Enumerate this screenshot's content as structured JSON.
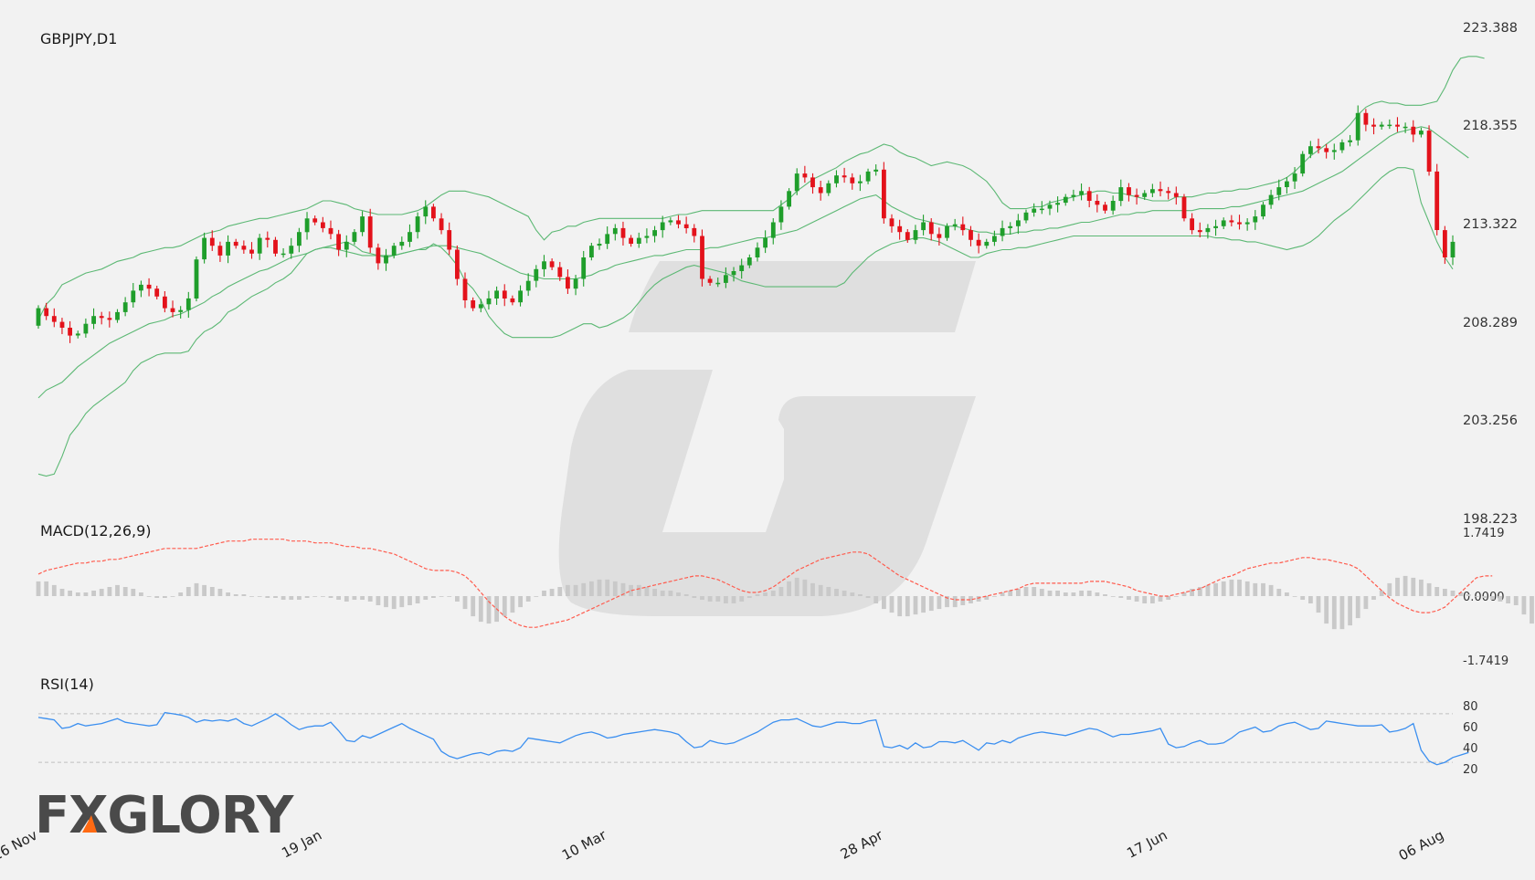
{
  "chart_data": {
    "type": "candlestick",
    "symbol_label": "GBPJPY,D1",
    "price_axis": {
      "ticks": [
        "223.388",
        "218.355",
        "213.322",
        "208.289",
        "203.256",
        "198.223"
      ],
      "ylim": [
        198.223,
        223.388
      ]
    },
    "date_ticks": [
      {
        "label": "26 Nov",
        "index": 0
      },
      {
        "label": "19 Jan",
        "index": 36
      },
      {
        "label": "10 Mar",
        "index": 72
      },
      {
        "label": "28 Apr",
        "index": 107
      },
      {
        "label": "17 Jun",
        "index": 143
      },
      {
        "label": "06 Aug",
        "index": 178
      }
    ],
    "candle_count": 180,
    "closes": [
      209.0,
      208.6,
      208.3,
      208.0,
      207.6,
      207.7,
      208.2,
      208.6,
      208.5,
      208.4,
      208.8,
      209.3,
      209.9,
      210.2,
      210.0,
      209.6,
      209.0,
      208.8,
      208.9,
      209.5,
      211.5,
      212.6,
      212.2,
      211.7,
      212.4,
      212.2,
      212.0,
      211.8,
      212.6,
      212.5,
      211.8,
      211.8,
      212.2,
      212.9,
      213.6,
      213.4,
      213.1,
      212.8,
      212.0,
      212.4,
      212.9,
      213.7,
      212.1,
      211.3,
      211.7,
      212.2,
      212.4,
      212.9,
      213.7,
      214.2,
      213.6,
      213.0,
      212.0,
      210.5,
      209.4,
      209.0,
      209.2,
      209.5,
      209.9,
      209.5,
      209.3,
      209.9,
      210.4,
      211.0,
      211.4,
      211.1,
      210.6,
      210.0,
      210.5,
      211.6,
      212.2,
      212.3,
      212.8,
      213.1,
      212.6,
      212.3,
      212.6,
      212.7,
      213.0,
      213.4,
      213.5,
      213.3,
      213.1,
      212.7,
      210.5,
      210.3,
      210.3,
      210.7,
      210.9,
      211.2,
      211.6,
      212.1,
      212.6,
      213.4,
      214.2,
      215.0,
      215.9,
      215.7,
      215.2,
      214.9,
      215.4,
      215.8,
      215.7,
      215.4,
      215.5,
      216.0,
      216.1,
      213.6,
      213.2,
      212.9,
      212.5,
      213.0,
      213.4,
      212.8,
      212.6,
      213.2,
      213.3,
      213.0,
      212.5,
      212.2,
      212.4,
      212.7,
      213.1,
      213.2,
      213.5,
      213.9,
      214.1,
      214.1,
      214.3,
      214.4,
      214.7,
      214.8,
      215.0,
      214.5,
      214.3,
      214.0,
      214.5,
      215.2,
      214.8,
      214.7,
      214.9,
      215.1,
      215.0,
      214.9,
      214.7,
      213.6,
      213.0,
      212.9,
      213.1,
      213.2,
      213.5,
      213.4,
      213.3,
      213.4,
      213.7,
      214.3,
      214.8,
      215.2,
      215.5,
      215.9,
      216.9,
      217.3,
      217.2,
      217.0,
      217.1,
      217.5,
      217.6,
      219.0,
      218.4,
      218.3,
      218.4,
      218.4,
      218.3,
      218.3,
      217.9,
      218.1,
      216.0,
      213.0,
      211.6,
      212.4,
      212.7,
      213.3
    ],
    "bollinger": {
      "bands": [
        "upper",
        "middle",
        "lower"
      ],
      "upper": [
        208.4,
        209.2,
        209.6,
        210.2,
        210.4,
        210.6,
        210.8,
        210.9,
        211.0,
        211.2,
        211.4,
        211.5,
        211.6,
        211.8,
        211.9,
        212.0,
        212.1,
        212.1,
        212.2,
        212.4,
        212.6,
        212.8,
        212.9,
        213.0,
        213.2,
        213.3,
        213.4,
        213.5,
        213.6,
        213.6,
        213.7,
        213.8,
        213.9,
        214.0,
        214.1,
        214.3,
        214.5,
        214.5,
        214.4,
        214.3,
        214.1,
        214.0,
        213.9,
        213.8,
        213.8,
        213.8,
        213.8,
        213.9,
        214.0,
        214.2,
        214.5,
        214.8,
        215.0,
        215.0,
        215.0,
        214.9,
        214.8,
        214.7,
        214.5,
        214.3,
        214.1,
        213.9,
        213.7,
        213.0,
        212.5,
        212.9,
        213.0,
        213.2,
        213.2,
        213.4,
        213.5,
        213.6,
        213.6,
        213.6,
        213.6,
        213.6,
        213.6,
        213.6,
        213.6,
        213.6,
        213.7,
        213.8,
        213.8,
        213.9,
        214.0,
        214.0,
        214.0,
        214.0,
        214.0,
        214.0,
        214.0,
        214.0,
        214.0,
        214.0,
        214.3,
        214.6,
        215.0,
        215.3,
        215.6,
        215.8,
        216.0,
        216.2,
        216.5,
        216.7,
        216.9,
        217.0,
        217.2,
        217.4,
        217.3,
        217.0,
        216.8,
        216.7,
        216.5,
        216.3,
        216.4,
        216.5,
        216.4,
        216.3,
        216.1,
        215.8,
        215.5,
        215.0,
        214.4,
        214.1,
        214.1,
        214.1,
        214.2,
        214.2,
        214.4,
        214.5,
        214.6,
        214.7,
        214.8,
        214.9,
        215.0,
        215.0,
        214.9,
        214.9,
        214.8,
        214.7,
        214.6,
        214.5,
        214.5,
        214.5,
        214.7,
        214.7,
        214.7,
        214.8,
        214.9,
        214.9,
        215.0,
        215.0,
        215.1,
        215.1,
        215.2,
        215.3,
        215.4,
        215.5,
        215.7,
        216.0,
        216.4,
        216.8,
        217.1,
        217.4,
        217.7,
        218.0,
        218.4,
        218.9,
        219.3,
        219.5,
        219.6,
        219.5,
        219.5,
        219.4,
        219.4,
        219.4,
        219.5,
        219.6,
        220.3,
        221.2,
        221.8,
        221.9,
        221.9,
        221.8
      ],
      "middle": [
        204.4,
        204.8,
        205.0,
        205.2,
        205.6,
        206.0,
        206.3,
        206.6,
        206.9,
        207.2,
        207.4,
        207.6,
        207.8,
        208.0,
        208.2,
        208.3,
        208.4,
        208.6,
        208.7,
        208.9,
        209.1,
        209.3,
        209.6,
        209.8,
        210.1,
        210.3,
        210.5,
        210.7,
        210.9,
        211.0,
        211.2,
        211.4,
        211.6,
        211.7,
        211.8,
        212.0,
        212.1,
        212.1,
        212.0,
        211.9,
        211.8,
        211.7,
        211.7,
        211.7,
        211.7,
        211.7,
        211.8,
        211.9,
        212.0,
        212.1,
        212.2,
        212.2,
        212.2,
        212.1,
        212.0,
        211.9,
        211.8,
        211.6,
        211.4,
        211.2,
        211.0,
        210.8,
        210.7,
        210.6,
        210.5,
        210.5,
        210.5,
        210.5,
        210.5,
        210.6,
        210.7,
        210.9,
        211.0,
        211.2,
        211.3,
        211.4,
        211.5,
        211.6,
        211.7,
        211.7,
        211.8,
        211.9,
        212.0,
        212.0,
        212.0,
        212.1,
        212.1,
        212.2,
        212.3,
        212.4,
        212.5,
        212.6,
        212.6,
        212.7,
        212.8,
        212.9,
        213.0,
        213.2,
        213.4,
        213.6,
        213.8,
        214.0,
        214.2,
        214.4,
        214.6,
        214.7,
        214.8,
        214.5,
        214.2,
        214.0,
        213.8,
        213.6,
        213.5,
        213.4,
        213.3,
        213.2,
        213.2,
        213.1,
        213.0,
        212.9,
        212.9,
        212.8,
        212.8,
        212.8,
        212.9,
        212.9,
        213.0,
        213.0,
        213.1,
        213.1,
        213.2,
        213.3,
        213.4,
        213.4,
        213.5,
        213.6,
        213.7,
        213.8,
        213.8,
        213.9,
        213.9,
        214.0,
        214.0,
        214.0,
        214.0,
        214.0,
        214.0,
        214.1,
        214.1,
        214.1,
        214.1,
        214.2,
        214.2,
        214.3,
        214.4,
        214.5,
        214.6,
        214.7,
        214.8,
        214.9,
        215.0,
        215.2,
        215.4,
        215.6,
        215.8,
        216.0,
        216.3,
        216.6,
        216.9,
        217.2,
        217.5,
        217.8,
        218.0,
        218.1,
        218.2,
        218.3,
        218.2,
        217.9,
        217.6,
        217.3,
        217.0,
        216.7
      ],
      "lower": [
        200.5,
        200.4,
        200.5,
        201.4,
        202.5,
        203.0,
        203.6,
        204.0,
        204.3,
        204.6,
        204.9,
        205.2,
        205.8,
        206.2,
        206.4,
        206.6,
        206.7,
        206.7,
        206.7,
        206.8,
        207.4,
        207.8,
        208.0,
        208.3,
        208.8,
        209.0,
        209.3,
        209.6,
        209.8,
        210.0,
        210.3,
        210.5,
        210.8,
        211.3,
        211.8,
        212.0,
        212.1,
        212.2,
        212.3,
        212.4,
        212.2,
        211.9,
        211.8,
        211.7,
        211.6,
        211.7,
        211.8,
        211.9,
        212.0,
        212.0,
        212.3,
        212.1,
        211.7,
        211.2,
        210.4,
        210.0,
        209.4,
        208.6,
        208.1,
        207.7,
        207.5,
        207.5,
        207.5,
        207.5,
        207.5,
        207.5,
        207.6,
        207.8,
        208.0,
        208.2,
        208.2,
        208.0,
        208.1,
        208.3,
        208.5,
        208.8,
        209.3,
        209.8,
        210.2,
        210.5,
        210.7,
        210.9,
        211.1,
        211.2,
        211.1,
        211.0,
        210.9,
        210.8,
        210.6,
        210.4,
        210.3,
        210.2,
        210.1,
        210.1,
        210.1,
        210.1,
        210.1,
        210.1,
        210.1,
        210.1,
        210.1,
        210.1,
        210.3,
        210.8,
        211.2,
        211.6,
        211.9,
        212.1,
        212.3,
        212.4,
        212.5,
        212.6,
        212.6,
        212.5,
        212.4,
        212.2,
        212.0,
        211.8,
        211.6,
        211.6,
        211.8,
        211.9,
        212.0,
        212.0,
        212.1,
        212.1,
        212.2,
        212.3,
        212.4,
        212.5,
        212.6,
        212.7,
        212.7,
        212.7,
        212.7,
        212.7,
        212.7,
        212.7,
        212.7,
        212.7,
        212.7,
        212.7,
        212.7,
        212.7,
        212.7,
        212.7,
        212.7,
        212.7,
        212.7,
        212.6,
        212.6,
        212.5,
        212.5,
        212.4,
        212.4,
        212.3,
        212.2,
        212.1,
        212.0,
        212.1,
        212.2,
        212.4,
        212.7,
        213.1,
        213.5,
        213.8,
        214.1,
        214.5,
        214.9,
        215.3,
        215.7,
        216.0,
        216.2,
        216.2,
        216.1,
        214.4,
        213.4,
        212.4,
        211.6,
        211.0
      ]
    },
    "macd": {
      "title": "MACD(12,26,9)",
      "ticks": [
        "1.7419",
        "0.0000",
        "-1.7419"
      ],
      "ylim": [
        -1.7419,
        1.7419
      ],
      "signal": [
        0.6,
        0.7,
        0.75,
        0.8,
        0.85,
        0.9,
        0.9,
        0.95,
        0.95,
        1.0,
        1.0,
        1.05,
        1.1,
        1.15,
        1.2,
        1.25,
        1.3,
        1.3,
        1.3,
        1.3,
        1.3,
        1.35,
        1.4,
        1.45,
        1.5,
        1.5,
        1.5,
        1.55,
        1.55,
        1.55,
        1.55,
        1.55,
        1.5,
        1.5,
        1.5,
        1.45,
        1.45,
        1.45,
        1.4,
        1.35,
        1.35,
        1.3,
        1.3,
        1.25,
        1.2,
        1.15,
        1.05,
        0.95,
        0.85,
        0.75,
        0.7,
        0.7,
        0.7,
        0.65,
        0.55,
        0.35,
        0.1,
        -0.15,
        -0.35,
        -0.55,
        -0.7,
        -0.8,
        -0.85,
        -0.85,
        -0.8,
        -0.75,
        -0.7,
        -0.65,
        -0.55,
        -0.45,
        -0.35,
        -0.25,
        -0.15,
        -0.05,
        0.05,
        0.15,
        0.2,
        0.25,
        0.3,
        0.35,
        0.4,
        0.45,
        0.5,
        0.55,
        0.55,
        0.5,
        0.45,
        0.35,
        0.25,
        0.15,
        0.1,
        0.1,
        0.15,
        0.25,
        0.4,
        0.55,
        0.7,
        0.8,
        0.9,
        1.0,
        1.05,
        1.1,
        1.15,
        1.2,
        1.2,
        1.15,
        1.0,
        0.85,
        0.7,
        0.55,
        0.45,
        0.35,
        0.25,
        0.15,
        0.05,
        -0.05,
        -0.1,
        -0.1,
        -0.1,
        -0.05,
        0.0,
        0.05,
        0.1,
        0.15,
        0.2,
        0.3,
        0.35,
        0.35,
        0.35,
        0.35,
        0.35,
        0.35,
        0.35,
        0.4,
        0.4,
        0.4,
        0.35,
        0.3,
        0.25,
        0.15,
        0.1,
        0.05,
        0.0,
        0.0,
        0.05,
        0.1,
        0.15,
        0.2,
        0.3,
        0.4,
        0.5,
        0.55,
        0.65,
        0.75,
        0.8,
        0.85,
        0.9,
        0.9,
        0.95,
        1.0,
        1.05,
        1.05,
        1.0,
        1.0,
        0.95,
        0.9,
        0.85,
        0.75,
        0.55,
        0.35,
        0.15,
        -0.05,
        -0.2,
        -0.3,
        -0.4,
        -0.45,
        -0.45,
        -0.4,
        -0.3,
        -0.1,
        0.1,
        0.3,
        0.5,
        0.55,
        0.55
      ],
      "histogram": [
        0.4,
        0.4,
        0.3,
        0.2,
        0.15,
        0.1,
        0.1,
        0.15,
        0.2,
        0.25,
        0.3,
        0.25,
        0.2,
        0.1,
        0.0,
        -0.05,
        -0.05,
        0.0,
        0.1,
        0.25,
        0.35,
        0.3,
        0.25,
        0.2,
        0.1,
        0.05,
        0.05,
        0.0,
        0.0,
        -0.05,
        -0.05,
        -0.1,
        -0.1,
        -0.1,
        -0.05,
        0.0,
        0.0,
        -0.05,
        -0.1,
        -0.15,
        -0.1,
        -0.1,
        -0.15,
        -0.25,
        -0.3,
        -0.35,
        -0.3,
        -0.25,
        -0.2,
        -0.1,
        -0.05,
        0.0,
        0.0,
        -0.15,
        -0.35,
        -0.55,
        -0.7,
        -0.75,
        -0.7,
        -0.55,
        -0.45,
        -0.3,
        -0.15,
        0.0,
        0.15,
        0.2,
        0.25,
        0.3,
        0.3,
        0.35,
        0.4,
        0.45,
        0.45,
        0.4,
        0.35,
        0.3,
        0.3,
        0.25,
        0.2,
        0.15,
        0.15,
        0.1,
        0.05,
        -0.05,
        -0.1,
        -0.15,
        -0.15,
        -0.2,
        -0.2,
        -0.15,
        -0.05,
        0.05,
        0.1,
        0.15,
        0.25,
        0.4,
        0.5,
        0.45,
        0.35,
        0.3,
        0.25,
        0.2,
        0.15,
        0.1,
        0.05,
        -0.05,
        -0.2,
        -0.35,
        -0.45,
        -0.55,
        -0.55,
        -0.5,
        -0.45,
        -0.4,
        -0.35,
        -0.3,
        -0.3,
        -0.25,
        -0.2,
        -0.15,
        -0.1,
        0.0,
        0.1,
        0.15,
        0.2,
        0.25,
        0.25,
        0.2,
        0.15,
        0.15,
        0.1,
        0.1,
        0.15,
        0.15,
        0.1,
        0.05,
        0.0,
        -0.05,
        -0.1,
        -0.15,
        -0.2,
        -0.2,
        -0.15,
        -0.1,
        0.0,
        0.1,
        0.2,
        0.25,
        0.3,
        0.35,
        0.4,
        0.45,
        0.45,
        0.4,
        0.35,
        0.35,
        0.3,
        0.2,
        0.1,
        0.0,
        -0.1,
        -0.2,
        -0.45,
        -0.75,
        -0.9,
        -0.9,
        -0.8,
        -0.6,
        -0.35,
        -0.1,
        0.15,
        0.35,
        0.5,
        0.55,
        0.5,
        0.45,
        0.35,
        0.25,
        0.2,
        0.15,
        0.1,
        0.05,
        0.0,
        -0.05,
        -0.1,
        -0.15,
        -0.2,
        -0.25,
        -0.5,
        -0.75,
        -1.0,
        -1.05,
        -0.9,
        -0.75
      ]
    },
    "rsi": {
      "title": "RSI(14)",
      "ticks": [
        "80",
        "60",
        "40",
        "20"
      ],
      "levels": [
        70,
        30
      ],
      "ylim": [
        15,
        85
      ],
      "values": [
        67,
        66,
        65,
        58,
        59,
        62,
        60,
        61,
        62,
        64,
        66,
        63,
        62,
        61,
        60,
        61,
        71,
        70,
        69,
        67,
        63,
        65,
        64,
        65,
        64,
        66,
        62,
        60,
        63,
        66,
        70,
        66,
        61,
        57,
        59,
        60,
        60,
        63,
        56,
        48,
        47,
        52,
        50,
        53,
        56,
        59,
        62,
        58,
        55,
        52,
        49,
        39,
        35,
        33,
        35,
        37,
        38,
        36,
        39,
        40,
        39,
        42,
        50,
        49,
        48,
        47,
        46,
        49,
        52,
        54,
        55,
        53,
        50,
        51,
        53,
        54,
        55,
        56,
        57,
        56,
        55,
        53,
        47,
        42,
        43,
        48,
        46,
        45,
        46,
        49,
        52,
        55,
        59,
        63,
        65,
        65,
        66,
        63,
        60,
        59,
        61,
        63,
        63,
        62,
        62,
        64,
        65,
        43,
        42,
        44,
        41,
        46,
        42,
        43,
        47,
        47,
        46,
        48,
        44,
        40,
        46,
        45,
        48,
        46,
        50,
        52,
        54,
        55,
        54,
        53,
        52,
        54,
        56,
        58,
        57,
        54,
        51,
        53,
        53,
        54,
        55,
        56,
        58,
        45,
        42,
        43,
        46,
        48,
        45,
        45,
        46,
        50,
        55,
        57,
        59,
        55,
        56,
        60,
        62,
        63,
        60,
        57,
        58,
        64,
        63,
        62,
        61,
        60,
        60,
        60,
        61,
        55,
        56,
        58,
        62,
        40,
        31,
        28,
        30,
        34,
        36,
        38
      ]
    },
    "colors": {
      "bull": "#1f9e2b",
      "bear": "#e3121b",
      "bands": "#5cb874",
      "macd_signal": "#ff5b4d",
      "histogram": "#c9c9c9",
      "rsi_line": "#3b8ff0",
      "level_lines": "#c0c0c0"
    }
  },
  "branding": {
    "logo_text": "FXGLORY",
    "accent_color": "#ff6a13"
  }
}
